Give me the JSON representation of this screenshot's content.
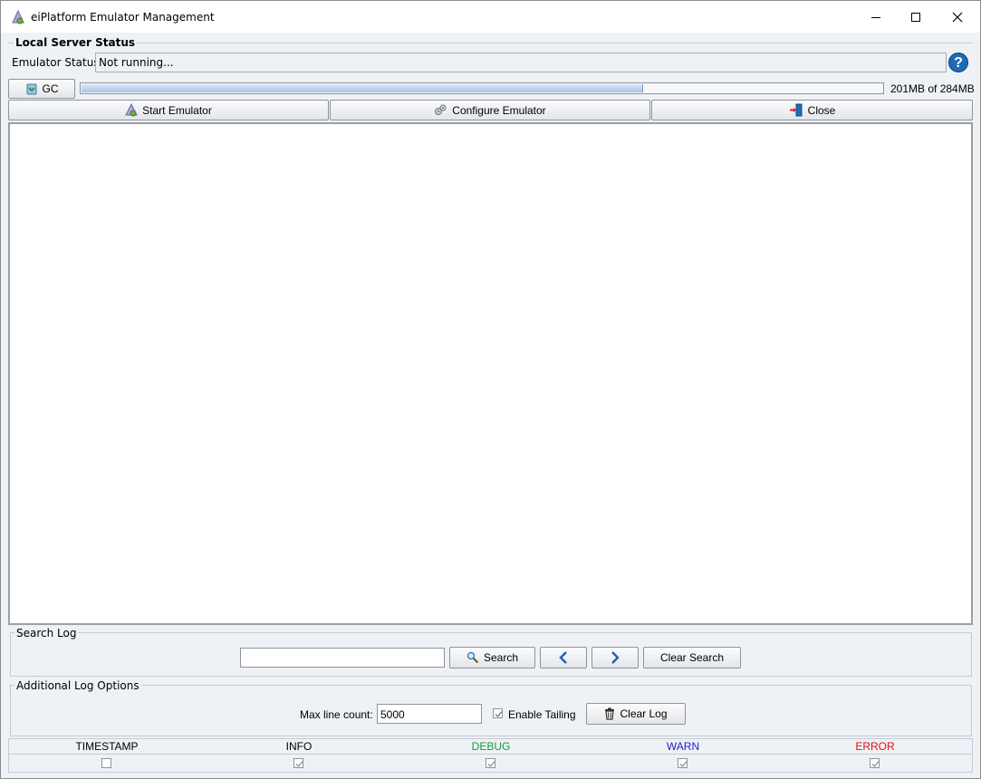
{
  "window": {
    "title": "eiPlatform Emulator Management",
    "controls": {
      "minimize": "minimize-icon",
      "maximize": "maximize-icon",
      "close": "close-icon"
    }
  },
  "server_status": {
    "legend": "Local Server Status",
    "label": "Emulator Status:",
    "value": "Not running...",
    "help_icon": "help-icon"
  },
  "memory": {
    "gc_label": "GC",
    "usage_text": "201MB of 284MB",
    "used_fraction": 0.7
  },
  "toolbar": {
    "start_label": "Start Emulator",
    "configure_label": "Configure Emulator",
    "close_label": "Close"
  },
  "search": {
    "legend": "Search Log",
    "query": "",
    "search_label": "Search",
    "prev_icon": "chevron-left-icon",
    "next_icon": "chevron-right-icon",
    "clear_label": "Clear Search"
  },
  "log_options": {
    "legend": "Additional Log Options",
    "max_line_label": "Max line count:",
    "max_line_value": "5000",
    "tailing_label": "Enable Tailing",
    "tailing_checked": true,
    "clear_log_label": "Clear Log"
  },
  "levels": [
    {
      "name": "TIMESTAMP",
      "color": "#000000",
      "checked": false
    },
    {
      "name": "INFO",
      "color": "#000000",
      "checked": true
    },
    {
      "name": "DEBUG",
      "color": "#1a9a3a",
      "checked": true
    },
    {
      "name": "WARN",
      "color": "#2020d0",
      "checked": true
    },
    {
      "name": "ERROR",
      "color": "#e01010",
      "checked": true
    }
  ]
}
